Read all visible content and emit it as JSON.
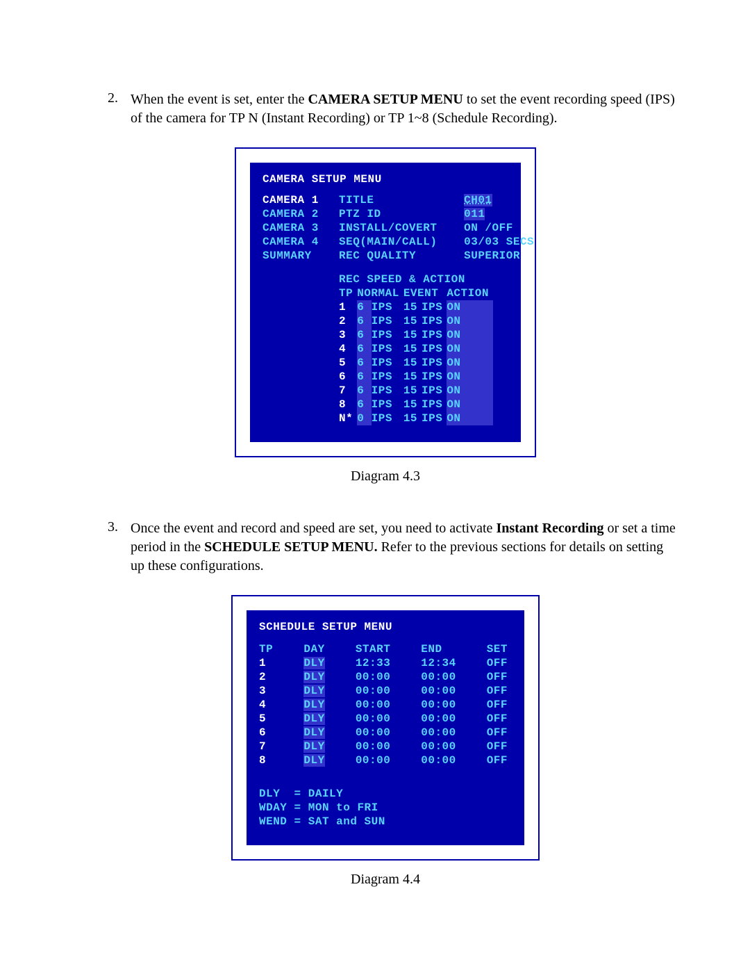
{
  "step2": {
    "num": "2.",
    "para_before_bold": "When the event is set, enter the ",
    "bold": "CAMERA SETUP MENU",
    "para_after": " to set the event recording speed (IPS) of the camera for TP N (Instant Recording) or TP 1~8 (Schedule Recording)."
  },
  "camera_menu": {
    "title": "CAMERA SETUP MENU",
    "sidebar": [
      "CAMERA 1",
      "CAMERA 2",
      "CAMERA 3",
      "CAMERA 4",
      "SUMMARY"
    ],
    "sidebar_selected_index": 0,
    "settings": [
      {
        "label": "TITLE",
        "value": "CH01",
        "value_class": "sel"
      },
      {
        "label": "PTZ ID",
        "value": "011",
        "value_class": "hl"
      },
      {
        "label": "INSTALL/COVERT",
        "value": "ON /OFF"
      },
      {
        "label": "SEQ(MAIN/CALL)",
        "value": "03/03 SECS"
      },
      {
        "label": "REC QUALITY",
        "value": "SUPERIOR"
      }
    ],
    "rec_title": "REC SPEED & ACTION",
    "rec_headers": {
      "tp": "TP",
      "normal": "NORMAL",
      "event": "EVENT",
      "action": "ACTION"
    },
    "rec_rows": [
      {
        "tp": "1",
        "n": "6",
        "nu": "IPS",
        "e": "15",
        "eu": "IPS",
        "a": "ON"
      },
      {
        "tp": "2",
        "n": "6",
        "nu": "IPS",
        "e": "15",
        "eu": "IPS",
        "a": "ON"
      },
      {
        "tp": "3",
        "n": "6",
        "nu": "IPS",
        "e": "15",
        "eu": "IPS",
        "a": "ON"
      },
      {
        "tp": "4",
        "n": "6",
        "nu": "IPS",
        "e": "15",
        "eu": "IPS",
        "a": "ON"
      },
      {
        "tp": "5",
        "n": "6",
        "nu": "IPS",
        "e": "15",
        "eu": "IPS",
        "a": "ON"
      },
      {
        "tp": "6",
        "n": "6",
        "nu": "IPS",
        "e": "15",
        "eu": "IPS",
        "a": "ON"
      },
      {
        "tp": "7",
        "n": "6",
        "nu": "IPS",
        "e": "15",
        "eu": "IPS",
        "a": "ON"
      },
      {
        "tp": "8",
        "n": "6",
        "nu": "IPS",
        "e": "15",
        "eu": "IPS",
        "a": "ON"
      },
      {
        "tp": "N*",
        "n": "0",
        "nu": "IPS",
        "e": "15",
        "eu": "IPS",
        "a": "ON"
      }
    ]
  },
  "caption43": "Diagram 4.3",
  "step3": {
    "num": "3.",
    "p1": "Once the event and record and speed are set, you need to activate ",
    "b1": "Instant Recording",
    "p2": " or set a time period in the ",
    "b2": "SCHEDULE SETUP MENU.",
    "p3": " Refer to the previous sections for details on setting up these configurations."
  },
  "schedule_menu": {
    "title": "SCHEDULE SETUP MENU",
    "headers": {
      "tp": "TP",
      "day": "DAY",
      "start": "START",
      "end": "END",
      "set": "SET"
    },
    "rows": [
      {
        "tp": "1",
        "day": "DLY",
        "start": "12:33",
        "end": "12:34",
        "set": "OFF"
      },
      {
        "tp": "2",
        "day": "DLY",
        "start": "00:00",
        "end": "00:00",
        "set": "OFF"
      },
      {
        "tp": "3",
        "day": "DLY",
        "start": "00:00",
        "end": "00:00",
        "set": "OFF"
      },
      {
        "tp": "4",
        "day": "DLY",
        "start": "00:00",
        "end": "00:00",
        "set": "OFF"
      },
      {
        "tp": "5",
        "day": "DLY",
        "start": "00:00",
        "end": "00:00",
        "set": "OFF"
      },
      {
        "tp": "6",
        "day": "DLY",
        "start": "00:00",
        "end": "00:00",
        "set": "OFF"
      },
      {
        "tp": "7",
        "day": "DLY",
        "start": "00:00",
        "end": "00:00",
        "set": "OFF"
      },
      {
        "tp": "8",
        "day": "DLY",
        "start": "00:00",
        "end": "00:00",
        "set": "OFF"
      }
    ],
    "legend": [
      {
        "k": "DLY",
        "eq": "=",
        "v": "DAILY"
      },
      {
        "k": "WDAY",
        "eq": "=",
        "v": "MON to FRI"
      },
      {
        "k": "WEND",
        "eq": "=",
        "v": "SAT and SUN"
      }
    ]
  },
  "caption44": "Diagram 4.4"
}
